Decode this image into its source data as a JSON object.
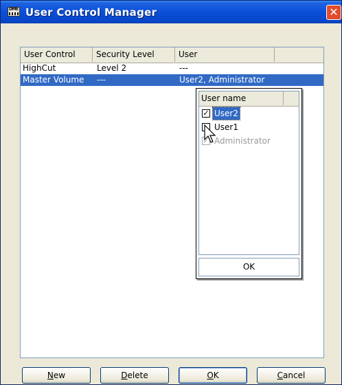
{
  "window": {
    "title": "User Control Manager",
    "close_glyph": "✕",
    "app_icon_text": "DME"
  },
  "table": {
    "columns": [
      "User Control",
      "Security Level",
      "User"
    ],
    "rows": [
      {
        "control": "HighCut",
        "level": "Level 2",
        "user": "---"
      },
      {
        "control": "Master Volume",
        "level": "---",
        "user": "User2, Administrator"
      }
    ]
  },
  "user_popup": {
    "header": "User name",
    "items": [
      {
        "label": "User2",
        "check": "✓",
        "checked": true,
        "selected": true,
        "disabled": false
      },
      {
        "label": "User1",
        "check": "",
        "checked": false,
        "selected": false,
        "disabled": false
      },
      {
        "label": "Administrator",
        "check": "✓",
        "checked": true,
        "selected": false,
        "disabled": true
      }
    ],
    "ok_label": "OK"
  },
  "buttons": {
    "new": {
      "mnemonic": "N",
      "rest": "ew"
    },
    "delete": {
      "mnemonic": "D",
      "rest": "elete"
    },
    "ok": {
      "mnemonic": "O",
      "rest": "K"
    },
    "cancel": {
      "mnemonic": "C",
      "rest": "ancel"
    }
  },
  "colors": {
    "selection": "#316ac5",
    "titlebar": "#0a4fd8",
    "close": "#e24c2c"
  }
}
